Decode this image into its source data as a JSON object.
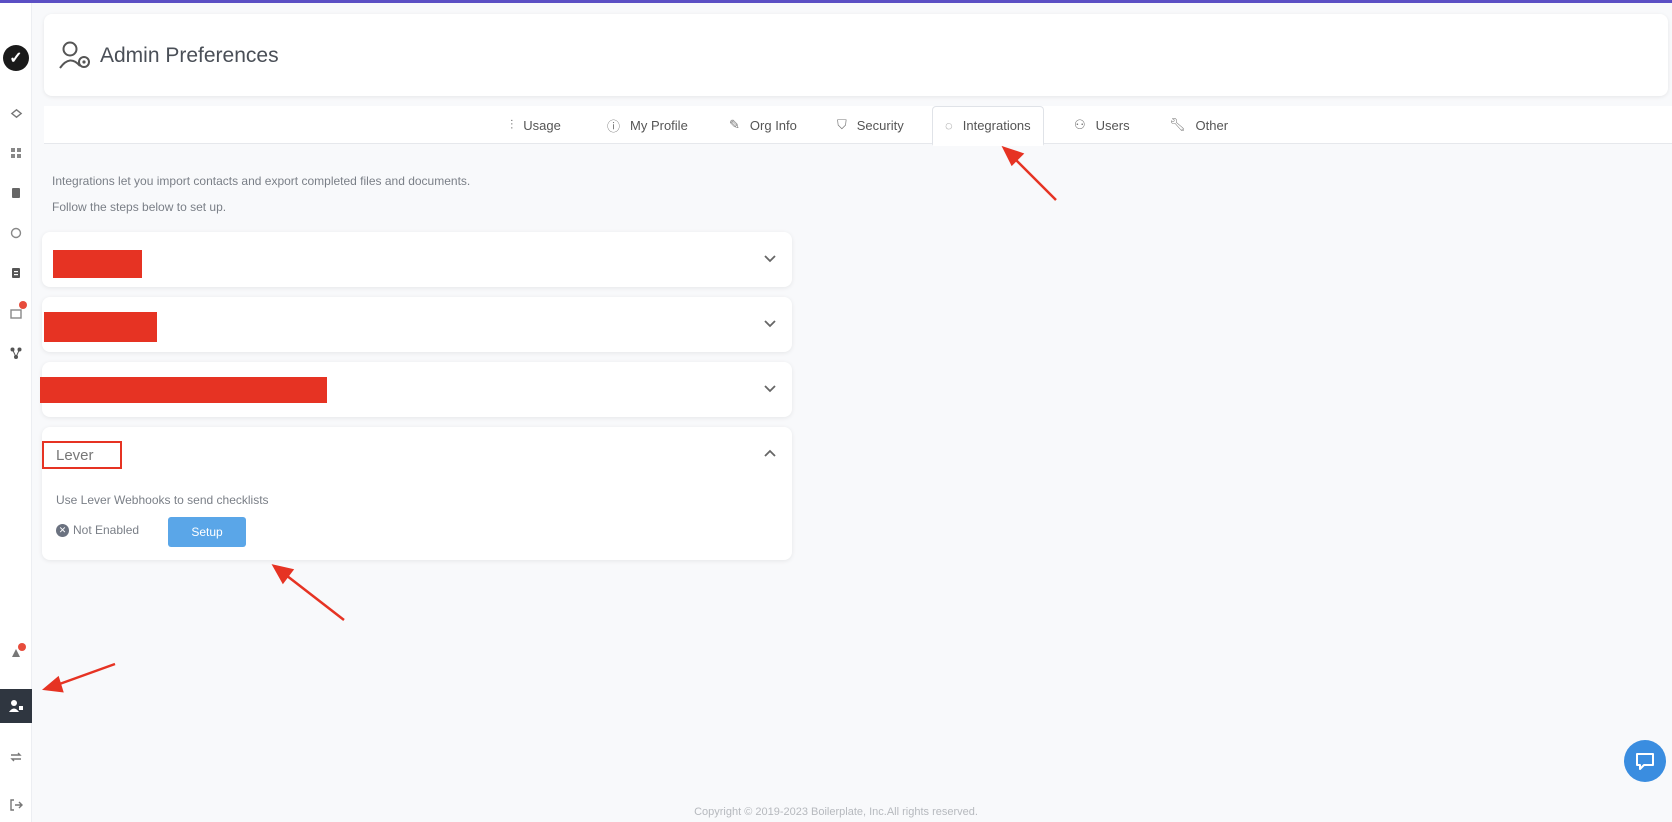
{
  "app": {
    "title": "Admin Preferences"
  },
  "sidebar": {
    "items": [
      {
        "icon": "dashboard-icon"
      },
      {
        "icon": "list-icon"
      },
      {
        "icon": "clipboard-icon"
      },
      {
        "icon": "chat-bubbles-icon"
      },
      {
        "icon": "document-icon"
      },
      {
        "icon": "inbox-icon"
      },
      {
        "icon": "workflow-icon"
      },
      {
        "icon": "notifications-icon"
      },
      {
        "icon": "admin-user-icon"
      },
      {
        "icon": "sync-icon"
      },
      {
        "icon": "logout-icon"
      }
    ]
  },
  "tabs": [
    {
      "label": "Usage",
      "icon": "chart-icon"
    },
    {
      "label": "My Profile",
      "icon": "info-icon"
    },
    {
      "label": "Org Info",
      "icon": "edit-icon"
    },
    {
      "label": "Security",
      "icon": "shield-icon"
    },
    {
      "label": "Integrations",
      "icon": "plug-icon",
      "active": true
    },
    {
      "label": "Users",
      "icon": "users-icon"
    },
    {
      "label": "Other",
      "icon": "wrench-icon"
    }
  ],
  "intro": {
    "line1": "Integrations let you import contacts and export completed files and documents.",
    "line2": "Follow the steps below to set up."
  },
  "integrations": {
    "lever": {
      "label": "Lever",
      "description": "Use Lever Webhooks to send checklists",
      "status": "Not Enabled",
      "setup_label": "Setup"
    }
  },
  "footer": {
    "copyright": "Copyright © 2019-2023 Boilerplate, Inc.All rights reserved."
  },
  "colors": {
    "accent": "#5aa6e8",
    "redaction": "#e63323",
    "sidebar_active": "#2f3640"
  }
}
